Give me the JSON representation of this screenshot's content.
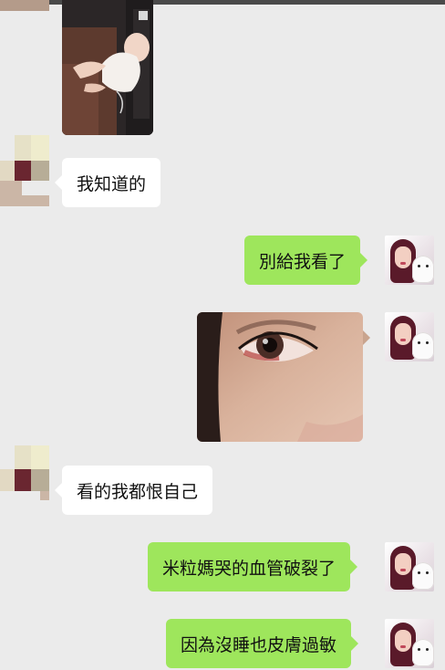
{
  "chat": {
    "messages": [
      {
        "side": "left",
        "type": "image",
        "alt": "baby photo"
      },
      {
        "side": "left",
        "type": "text",
        "text": "我知道的"
      },
      {
        "side": "right",
        "type": "text",
        "text": "別給我看了"
      },
      {
        "side": "right",
        "type": "image",
        "alt": "eye photo"
      },
      {
        "side": "left",
        "type": "text",
        "text": "看的我都恨自己"
      },
      {
        "side": "right",
        "type": "text",
        "text": "米粒媽哭的血管破裂了"
      },
      {
        "side": "right",
        "type": "text",
        "text": "因為沒睡也皮膚過敏"
      }
    ]
  },
  "colors": {
    "background": "#ebebeb",
    "bubble_left": "#ffffff",
    "bubble_right": "#9ee65c"
  }
}
